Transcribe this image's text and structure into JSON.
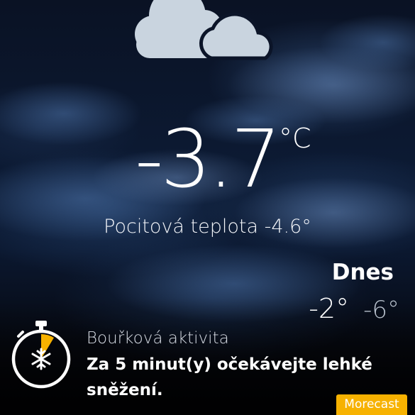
{
  "current": {
    "condition_icon": "cloudy-icon",
    "temperature": "-3.7",
    "unit": "°C",
    "feels_like_label": "Pocitová teplota",
    "feels_like_value": "-4.6°"
  },
  "today": {
    "label": "Dnes",
    "high": "-2°",
    "low": "-6°"
  },
  "alert": {
    "icon": "stopwatch-snowflake-icon",
    "title": "Bouřková aktivita",
    "message": "Za 5 minut(y) očekávejte lehké sněžení.",
    "accent_color": "#f7b200"
  },
  "brand": {
    "label": "Morecast",
    "color": "#f7b200"
  }
}
